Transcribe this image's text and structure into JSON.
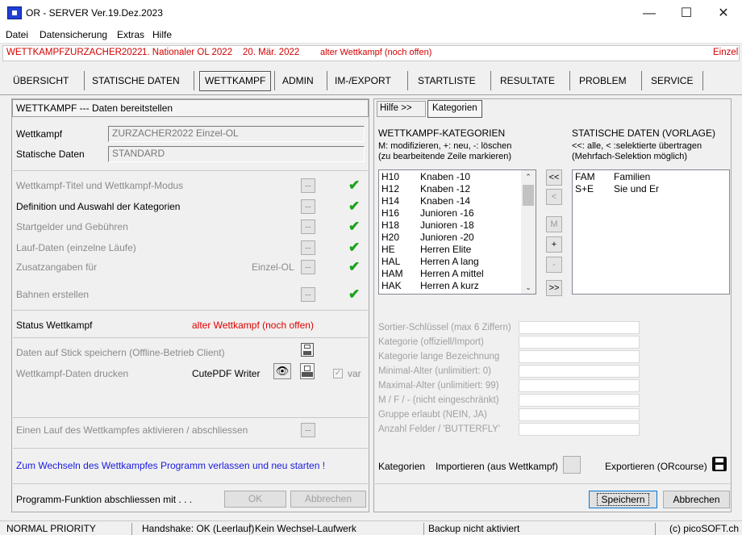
{
  "window": {
    "title": "OR - SERVER   Ver.19.Dez.2023",
    "minimize": "—",
    "maximize": "☐",
    "close": "✕"
  },
  "menu": [
    "Datei",
    "Datensicherung",
    "Extras",
    "Hilfe"
  ],
  "competition": {
    "label": "WETTKAMPF:",
    "name": "ZURZACHER2022",
    "event": "1. Nationaler OL 2022",
    "date": "20. Mär. 2022",
    "state": "alter Wettkampf (noch offen)",
    "mode": "Einzel"
  },
  "tabs": [
    "ÜBERSICHT",
    "STATISCHE DATEN",
    "WETTKAMPF",
    "ADMIN",
    "IM-/EXPORT",
    "STARTLISTE",
    "RESULTATE",
    "PROBLEM",
    "SERVICE"
  ],
  "left": {
    "header": "WETTKAMPF --- Daten bereitstellen",
    "wettkampf_label": "Wettkampf",
    "wettkampf_value": "ZURZACHER2022    Einzel-OL",
    "statisch_label": "Statische Daten",
    "statisch_value": "STANDARD",
    "steps": [
      "Wettkampf-Titel und Wettkampf-Modus",
      "Definition und Auswahl der Kategorien",
      "Startgelder und Gebühren",
      "Lauf-Daten (einzelne Läufe)",
      "Zusatzangaben für",
      "Bahnen erstellen"
    ],
    "step_extra": "Einzel-OL",
    "dots": "...",
    "status_label": "Status Wettkampf",
    "status_value": "alter Wettkampf (noch offen)",
    "stick_label": "Daten auf Stick speichern (Offline-Betrieb Client)",
    "print_label": "Wettkampf-Daten drucken",
    "printer": "CutePDF Writer",
    "var_label": "var",
    "activate_label": "Einen Lauf des Wettkampfes aktivieren / abschliessen",
    "restart_hint": "Zum Wechseln des Wettkampfes Programm verlassen und neu starten !",
    "finish_label": "Programm-Funktion abschliessen mit . . .",
    "ok": "OK",
    "cancel": "Abbrechen"
  },
  "right": {
    "subtabs": [
      "Hilfe >>",
      "Kategorien"
    ],
    "cat_title": "WETTKAMPF-KATEGORIEN",
    "cat_hint1": "M: modifizieren, +: neu, -: löschen",
    "cat_hint2": "(zu bearbeitende Zeile markieren)",
    "static_title": "STATISCHE DATEN (VORLAGE)",
    "static_hint1": "<<: alle, < :selektierte übertragen",
    "static_hint2": "(Mehrfach-Selektion möglich)",
    "categories": [
      {
        "code": "H10",
        "name": "Knaben -10"
      },
      {
        "code": "H12",
        "name": "Knaben -12"
      },
      {
        "code": "H14",
        "name": "Knaben -14"
      },
      {
        "code": "H16",
        "name": "Junioren -16"
      },
      {
        "code": "H18",
        "name": "Junioren -18"
      },
      {
        "code": "H20",
        "name": "Junioren -20"
      },
      {
        "code": "HE",
        "name": "Herren Elite"
      },
      {
        "code": "HAL",
        "name": "Herren A lang"
      },
      {
        "code": "HAM",
        "name": "Herren A mittel"
      },
      {
        "code": "HAK",
        "name": "Herren A kurz"
      }
    ],
    "templates": [
      {
        "code": "FAM",
        "name": "Familien"
      },
      {
        "code": "S+E",
        "name": "Sie und Er"
      }
    ],
    "mid_buttons": [
      "<<",
      "<",
      "M",
      "+",
      "-",
      ">>"
    ],
    "form_labels": [
      "Sortier-Schlüssel (max 6 Ziffern)",
      "Kategorie (offiziell/Import)",
      "Kategorie lange Bezeichnung",
      "Minimal-Alter  (unlimitiert:  0)",
      "Maximal-Alter (unlimitiert: 99)",
      "M / F / - (nicht eingeschränkt)",
      "Gruppe erlaubt (NEIN, JA)",
      "Anzahl Felder / 'BUTTERFLY'"
    ],
    "kat_label": "Kategorien",
    "import_label": "Importieren (aus Wettkampf)",
    "export_label": "Exportieren (ORcourse)",
    "save": "Speichern",
    "cancel": "Abbrechen"
  },
  "statusbar": [
    "NORMAL PRIORITY",
    "Handshake: OK (Leerlauf)",
    "Kein Wechsel-Laufwerk",
    "Backup nicht aktiviert",
    "(c) picoSOFT.ch"
  ]
}
